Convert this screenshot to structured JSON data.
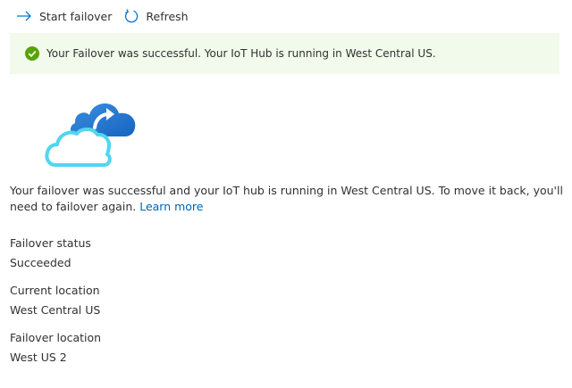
{
  "toolbar": {
    "start_failover_label": "Start failover",
    "refresh_label": "Refresh"
  },
  "banner": {
    "message": "Your Failover was successful. Your IoT Hub is running in West Central US.",
    "status_color": "#57a300",
    "background": "#f1faeb"
  },
  "description": {
    "text": "Your failover was successful and your IoT hub is running in West Central US. To move it back, you'll need to failover again.",
    "link": "Learn more"
  },
  "fields": {
    "failover_status": {
      "label": "Failover status",
      "value": "Succeeded"
    },
    "current_location": {
      "label": "Current location",
      "value": "West Central US"
    },
    "failover_location": {
      "label": "Failover location",
      "value": "West US 2"
    }
  },
  "colors": {
    "accent": "#0078d4",
    "link": "#0063b1"
  }
}
